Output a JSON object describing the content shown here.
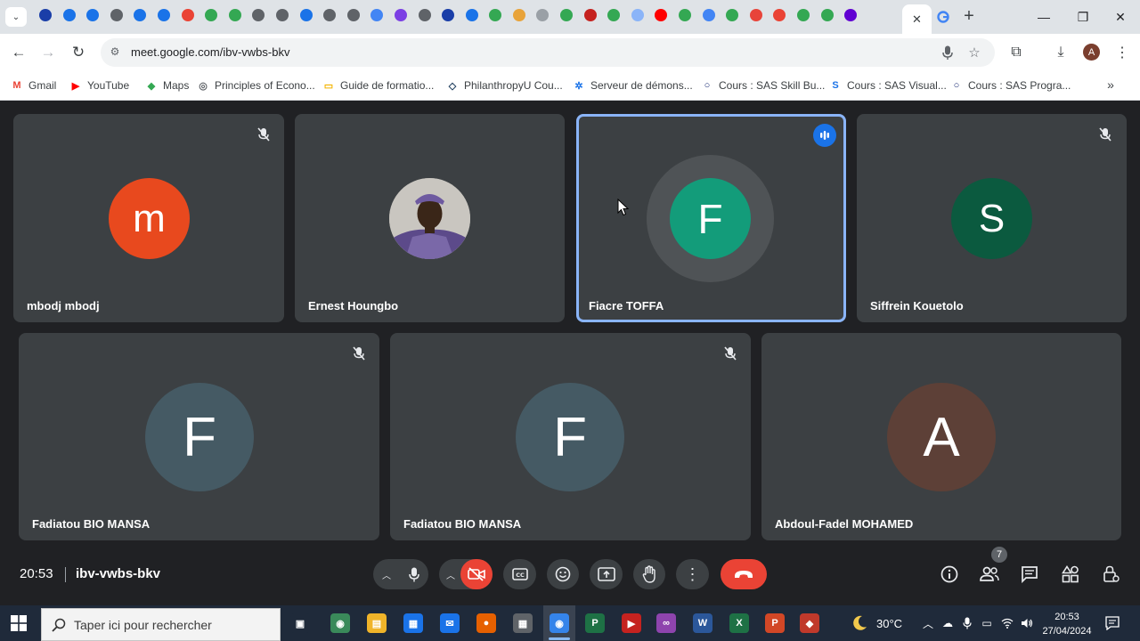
{
  "browser": {
    "tab_favicons": [
      {
        "name": "tab-favicon-1",
        "color": "#1a3ea8"
      },
      {
        "name": "tab-favicon-2",
        "color": "#1a73e8"
      },
      {
        "name": "tab-favicon-3",
        "color": "#1a73e8"
      },
      {
        "name": "tab-favicon-4",
        "color": "#5f6368"
      },
      {
        "name": "tab-favicon-5",
        "color": "#1a73e8"
      },
      {
        "name": "tab-favicon-6",
        "color": "#1a73e8"
      },
      {
        "name": "tab-favicon-7",
        "color": "#ea4335"
      },
      {
        "name": "tab-favicon-8",
        "color": "#34a853"
      },
      {
        "name": "tab-favicon-9",
        "color": "#34a853"
      },
      {
        "name": "tab-favicon-10",
        "color": "#5f6368"
      },
      {
        "name": "tab-favicon-11",
        "color": "#5f6368"
      },
      {
        "name": "tab-favicon-12",
        "color": "#1a73e8"
      },
      {
        "name": "tab-favicon-13",
        "color": "#5f6368"
      },
      {
        "name": "tab-favicon-14",
        "color": "#5f6368"
      },
      {
        "name": "tab-favicon-15",
        "color": "#4285f4"
      },
      {
        "name": "tab-favicon-16",
        "color": "#7b3fe4"
      },
      {
        "name": "tab-favicon-17",
        "color": "#5f6368"
      },
      {
        "name": "tab-favicon-18",
        "color": "#1a3ea8"
      },
      {
        "name": "tab-favicon-19",
        "color": "#1a73e8"
      },
      {
        "name": "tab-favicon-20",
        "color": "#34a853"
      },
      {
        "name": "tab-favicon-21",
        "color": "#e8a33a"
      },
      {
        "name": "tab-favicon-22",
        "color": "#9aa0a6"
      },
      {
        "name": "tab-favicon-23",
        "color": "#34a853"
      },
      {
        "name": "tab-favicon-24",
        "color": "#c5221f"
      },
      {
        "name": "tab-favicon-25",
        "color": "#34a853"
      },
      {
        "name": "tab-favicon-26",
        "color": "#8ab4f8"
      },
      {
        "name": "tab-favicon-27",
        "color": "#ff0000"
      },
      {
        "name": "tab-favicon-28",
        "color": "#34a853"
      },
      {
        "name": "tab-favicon-29",
        "color": "#4285f4"
      },
      {
        "name": "tab-favicon-30",
        "color": "#34a853"
      },
      {
        "name": "tab-favicon-31",
        "color": "#e8443a"
      },
      {
        "name": "tab-favicon-32",
        "color": "#ea4335"
      },
      {
        "name": "tab-favicon-33",
        "color": "#34a853"
      },
      {
        "name": "tab-favicon-34",
        "color": "#34a853"
      },
      {
        "name": "tab-favicon-35",
        "color": "#6001d2"
      }
    ],
    "url": "meet.google.com/ibv-vwbs-bkv",
    "profile_initial": "A",
    "bookmarks": [
      {
        "label": "Gmail",
        "icon_color": "#ea4335",
        "glyph": "M"
      },
      {
        "label": "YouTube",
        "icon_color": "#ff0000",
        "glyph": "▶"
      },
      {
        "label": "Maps",
        "icon_color": "#34a853",
        "glyph": "◆"
      },
      {
        "label": "Principles of Econo...",
        "icon_color": "#5f6368",
        "glyph": "◎"
      },
      {
        "label": "Guide de formatio...",
        "icon_color": "#f4b400",
        "glyph": "▭"
      },
      {
        "label": "PhilanthropyU Cou...",
        "icon_color": "#1a3a5a",
        "glyph": "◇"
      },
      {
        "label": "Serveur de démons...",
        "icon_color": "#1a73e8",
        "glyph": "✲"
      },
      {
        "label": "Cours : SAS Skill Bu...",
        "icon_color": "#0b1e6b",
        "glyph": "○"
      },
      {
        "label": "Cours : SAS Visual...",
        "icon_color": "#1a73e8",
        "glyph": "S"
      },
      {
        "label": "Cours : SAS Progra...",
        "icon_color": "#0b1e6b",
        "glyph": "○"
      }
    ]
  },
  "participants": [
    {
      "name": "mbodj mbodj",
      "initial": "m",
      "avatar_color": "#e8491e",
      "status": "muted"
    },
    {
      "name": "Ernest Houngbo",
      "initial": "",
      "avatar_color": "#6a5a8a",
      "status": "none",
      "photo": true
    },
    {
      "name": "Fiacre TOFFA",
      "initial": "F",
      "avatar_color": "#139c7a",
      "status": "speaking"
    },
    {
      "name": "Siffrein Kouetolo",
      "initial": "S",
      "avatar_color": "#0b5a3f",
      "status": "muted"
    },
    {
      "name": "Fadiatou BIO MANSA",
      "initial": "F",
      "avatar_color": "#455a64",
      "status": "muted"
    },
    {
      "name": "Fadiatou BIO MANSA",
      "initial": "F",
      "avatar_color": "#455a64",
      "status": "muted"
    },
    {
      "name": "Abdoul-Fadel MOHAMED",
      "initial": "A",
      "avatar_color": "#5d4037",
      "status": "none"
    }
  ],
  "meeting": {
    "time": "20:53",
    "code": "ibv-vwbs-bkv",
    "participant_count": "7"
  },
  "taskbar": {
    "search_placeholder": "Taper ici pour rechercher",
    "weather": "30°C",
    "time": "20:53",
    "date": "27/04/2024",
    "apps": [
      {
        "name": "task-view-icon",
        "color": "#1f2a3a",
        "glyph": "▣"
      },
      {
        "name": "widgets-icon",
        "color": "#3a8a5a",
        "glyph": "◉"
      },
      {
        "name": "file-explorer-icon",
        "color": "#f0b429",
        "glyph": "▤"
      },
      {
        "name": "store-icon",
        "color": "#1a73e8",
        "glyph": "▦"
      },
      {
        "name": "mail-icon",
        "color": "#1a73e8",
        "glyph": "✉"
      },
      {
        "name": "firefox-icon",
        "color": "#e66000",
        "glyph": "●"
      },
      {
        "name": "calculator-icon",
        "color": "#5f6368",
        "glyph": "▦"
      },
      {
        "name": "chrome-icon",
        "color": "#1a73e8",
        "glyph": "◉"
      },
      {
        "name": "project-icon",
        "color": "#1e7145",
        "glyph": "P"
      },
      {
        "name": "media-player-icon",
        "color": "#c5221f",
        "glyph": "▶"
      },
      {
        "name": "studio-icon",
        "color": "#8e44ad",
        "glyph": "∞"
      },
      {
        "name": "word-icon",
        "color": "#2b579a",
        "glyph": "W"
      },
      {
        "name": "excel-icon",
        "color": "#1e7145",
        "glyph": "X"
      },
      {
        "name": "powerpoint-icon",
        "color": "#d24726",
        "glyph": "P"
      },
      {
        "name": "app-icon",
        "color": "#c0392b",
        "glyph": "◆"
      }
    ]
  }
}
